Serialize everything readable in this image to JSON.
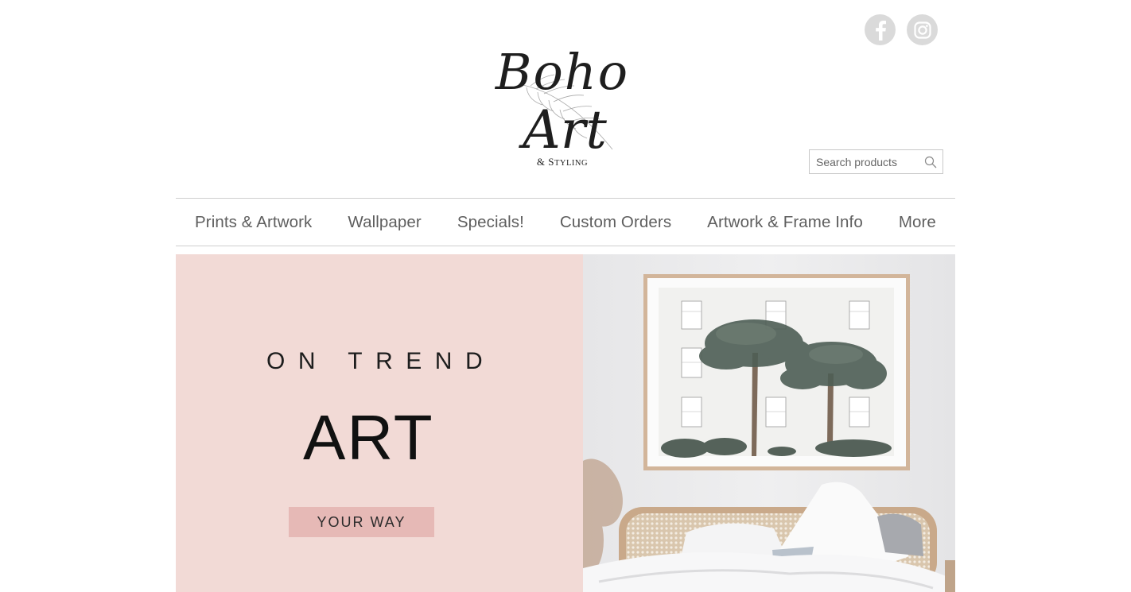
{
  "brand": {
    "logo_line1": "Boho",
    "logo_line2": "Art",
    "logo_sub_amp": "& S",
    "logo_sub_rest": "TYLING"
  },
  "social": [
    {
      "name": "facebook",
      "icon": "facebook-icon"
    },
    {
      "name": "instagram",
      "icon": "instagram-icon"
    }
  ],
  "search": {
    "placeholder": "Search products",
    "value": "",
    "icon": "search-icon"
  },
  "nav": {
    "items": [
      {
        "label": "Prints & Artwork"
      },
      {
        "label": "Wallpaper"
      },
      {
        "label": "Specials!"
      },
      {
        "label": "Custom Orders"
      },
      {
        "label": "Artwork & Frame Info"
      },
      {
        "label": "More"
      }
    ]
  },
  "hero": {
    "tagline": "ON TREND",
    "headline": "ART",
    "cta_label": "YOUR WAY",
    "image_alt": "Framed palm tree print above rattan bed",
    "colors": {
      "panel_bg": "#f2dad6",
      "cta_bg": "#e6b9b6"
    }
  }
}
